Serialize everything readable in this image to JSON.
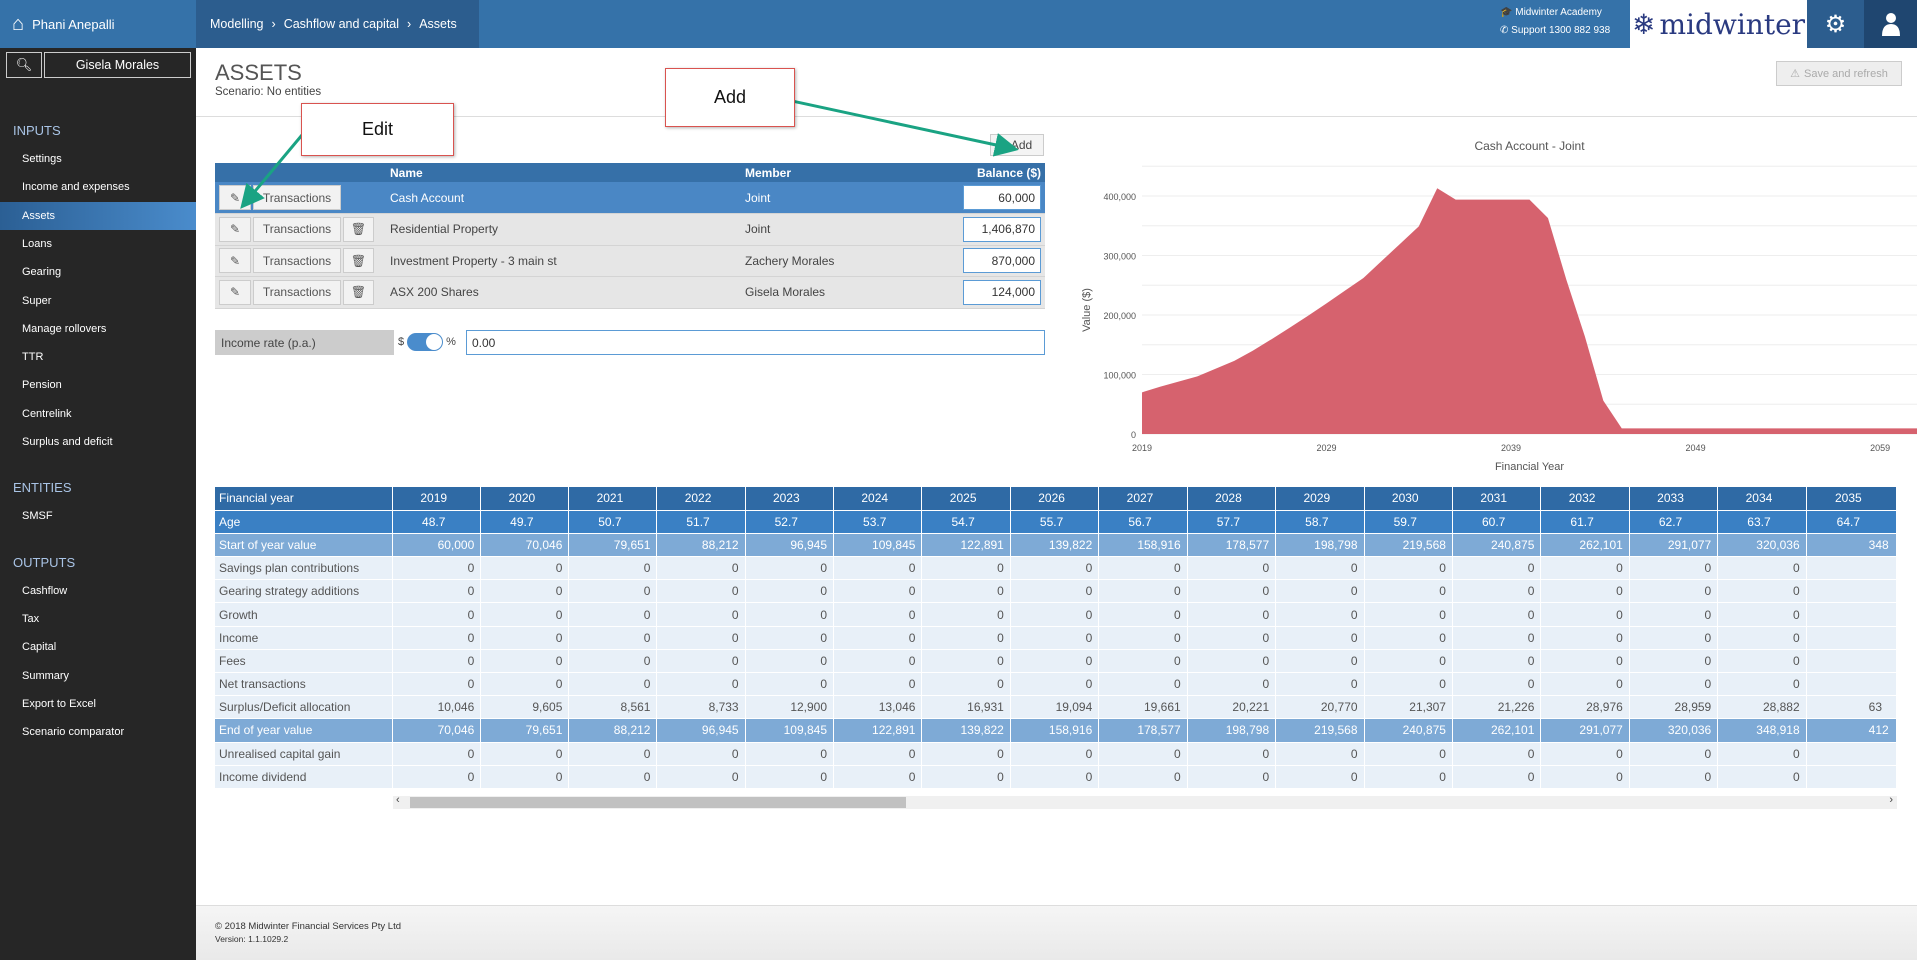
{
  "topbar": {
    "user": "Phani Anepalli",
    "breadcrumb": [
      "Modelling",
      "Cashflow and capital",
      "Assets"
    ],
    "academy": "Midwinter Academy",
    "support": "Support 1300 882 938",
    "logo": "midwinter"
  },
  "sidebar": {
    "search_value": "Gisela Morales",
    "sections": [
      {
        "title": "INPUTS",
        "items": [
          "Settings",
          "Income and expenses",
          "Assets",
          "Loans",
          "Gearing",
          "Super",
          "Manage rollovers",
          "TTR",
          "Pension",
          "Centrelink",
          "Surplus and deficit"
        ]
      },
      {
        "title": "ENTITIES",
        "items": [
          "SMSF"
        ]
      },
      {
        "title": "OUTPUTS",
        "items": [
          "Cashflow",
          "Tax",
          "Capital",
          "Summary",
          "Export to Excel",
          "Scenario comparator"
        ]
      }
    ],
    "active": "Assets"
  },
  "page": {
    "title": "ASSETS",
    "scenario": "Scenario: No entities",
    "save_label": "Save and refresh",
    "add_label": "Add"
  },
  "callouts": {
    "edit": "Edit",
    "add": "Add"
  },
  "assets": {
    "headers": [
      "",
      "Name",
      "Member",
      "Balance ($)"
    ],
    "transactions_label": "Transactions",
    "rows": [
      {
        "name": "Cash Account",
        "member": "Joint",
        "balance": "60,000",
        "selected": true
      },
      {
        "name": "Residential Property",
        "member": "Joint",
        "balance": "1,406,870"
      },
      {
        "name": "Investment Property - 3 main st",
        "member": "Zachery Morales",
        "balance": "870,000"
      },
      {
        "name": "ASX 200 Shares",
        "member": "Gisela Morales",
        "balance": "124,000"
      }
    ]
  },
  "income_rate": {
    "label": "Income rate (p.a.)",
    "left": "$",
    "right": "%",
    "value": "0.00",
    "mode": "%"
  },
  "chart_data": {
    "type": "area",
    "title": "Cash Account - Joint",
    "xlabel": "Financial Year",
    "ylabel": "Value ($)",
    "xlim": [
      2019,
      2061
    ],
    "ylim": [
      0,
      450000
    ],
    "xticks": [
      2019,
      2029,
      2039,
      2049,
      2059
    ],
    "yticks": [
      0,
      100000,
      200000,
      300000,
      400000
    ],
    "ytick_labels": [
      "0",
      "100,000",
      "200,000",
      "300,000",
      "400,000"
    ],
    "grid": true,
    "color": "#d45a66",
    "x": [
      2019,
      2020,
      2021,
      2022,
      2023,
      2024,
      2025,
      2026,
      2027,
      2028,
      2029,
      2030,
      2031,
      2032,
      2033,
      2034,
      2035,
      2036,
      2037,
      2038,
      2039,
      2040,
      2041,
      2042,
      2043,
      2044,
      2045,
      2050,
      2055,
      2061
    ],
    "y": [
      70046,
      79651,
      88212,
      96945,
      109845,
      122891,
      139822,
      158916,
      178577,
      198798,
      219568,
      240875,
      262101,
      291077,
      320036,
      348918,
      413000,
      394000,
      394000,
      394000,
      394000,
      394000,
      363000,
      259000,
      164000,
      56000,
      9500,
      9500,
      9500,
      9500
    ]
  },
  "projection": {
    "years": [
      "2019",
      "2020",
      "2021",
      "2022",
      "2023",
      "2024",
      "2025",
      "2026",
      "2027",
      "2028",
      "2029",
      "2030",
      "2031",
      "2032",
      "2033",
      "2034",
      "2035"
    ],
    "rows": [
      {
        "label": "Financial year",
        "style": "hdr",
        "values": [
          "2019",
          "2020",
          "2021",
          "2022",
          "2023",
          "2024",
          "2025",
          "2026",
          "2027",
          "2028",
          "2029",
          "2030",
          "2031",
          "2032",
          "2033",
          "2034",
          "2035"
        ]
      },
      {
        "label": "Age",
        "style": "age",
        "values": [
          "48.7",
          "49.7",
          "50.7",
          "51.7",
          "52.7",
          "53.7",
          "54.7",
          "55.7",
          "56.7",
          "57.7",
          "58.7",
          "59.7",
          "60.7",
          "61.7",
          "62.7",
          "63.7",
          "64.7"
        ]
      },
      {
        "label": "Start of year value",
        "style": "hi",
        "values": [
          "60,000",
          "70,046",
          "79,651",
          "88,212",
          "96,945",
          "109,845",
          "122,891",
          "139,822",
          "158,916",
          "178,577",
          "198,798",
          "219,568",
          "240,875",
          "262,101",
          "291,077",
          "320,036",
          "348"
        ]
      },
      {
        "label": "Savings plan contributions",
        "style": "nm",
        "values": [
          "0",
          "0",
          "0",
          "0",
          "0",
          "0",
          "0",
          "0",
          "0",
          "0",
          "0",
          "0",
          "0",
          "0",
          "0",
          "0",
          ""
        ]
      },
      {
        "label": "Gearing strategy additions",
        "style": "nm",
        "values": [
          "0",
          "0",
          "0",
          "0",
          "0",
          "0",
          "0",
          "0",
          "0",
          "0",
          "0",
          "0",
          "0",
          "0",
          "0",
          "0",
          ""
        ]
      },
      {
        "label": "Growth",
        "style": "nm",
        "values": [
          "0",
          "0",
          "0",
          "0",
          "0",
          "0",
          "0",
          "0",
          "0",
          "0",
          "0",
          "0",
          "0",
          "0",
          "0",
          "0",
          ""
        ]
      },
      {
        "label": "Income",
        "style": "nm",
        "values": [
          "0",
          "0",
          "0",
          "0",
          "0",
          "0",
          "0",
          "0",
          "0",
          "0",
          "0",
          "0",
          "0",
          "0",
          "0",
          "0",
          ""
        ]
      },
      {
        "label": "Fees",
        "style": "nm",
        "values": [
          "0",
          "0",
          "0",
          "0",
          "0",
          "0",
          "0",
          "0",
          "0",
          "0",
          "0",
          "0",
          "0",
          "0",
          "0",
          "0",
          ""
        ]
      },
      {
        "label": "Net transactions",
        "style": "nm",
        "values": [
          "0",
          "0",
          "0",
          "0",
          "0",
          "0",
          "0",
          "0",
          "0",
          "0",
          "0",
          "0",
          "0",
          "0",
          "0",
          "0",
          ""
        ]
      },
      {
        "label": "Surplus/Deficit allocation",
        "style": "nm",
        "values": [
          "10,046",
          "9,605",
          "8,561",
          "8,733",
          "12,900",
          "13,046",
          "16,931",
          "19,094",
          "19,661",
          "20,221",
          "20,770",
          "21,307",
          "21,226",
          "28,976",
          "28,959",
          "28,882",
          "63"
        ]
      },
      {
        "label": "End of year value",
        "style": "hi",
        "values": [
          "70,046",
          "79,651",
          "88,212",
          "96,945",
          "109,845",
          "122,891",
          "139,822",
          "158,916",
          "178,577",
          "198,798",
          "219,568",
          "240,875",
          "262,101",
          "291,077",
          "320,036",
          "348,918",
          "412"
        ]
      },
      {
        "label": "Unrealised capital gain",
        "style": "nm",
        "values": [
          "0",
          "0",
          "0",
          "0",
          "0",
          "0",
          "0",
          "0",
          "0",
          "0",
          "0",
          "0",
          "0",
          "0",
          "0",
          "0",
          ""
        ]
      },
      {
        "label": "Income dividend",
        "style": "nm",
        "values": [
          "0",
          "0",
          "0",
          "0",
          "0",
          "0",
          "0",
          "0",
          "0",
          "0",
          "0",
          "0",
          "0",
          "0",
          "0",
          "0",
          ""
        ]
      }
    ]
  },
  "footer": {
    "copyright": "© 2018 Midwinter Financial Services Pty Ltd",
    "version": "Version: 1.1.1029.2"
  }
}
